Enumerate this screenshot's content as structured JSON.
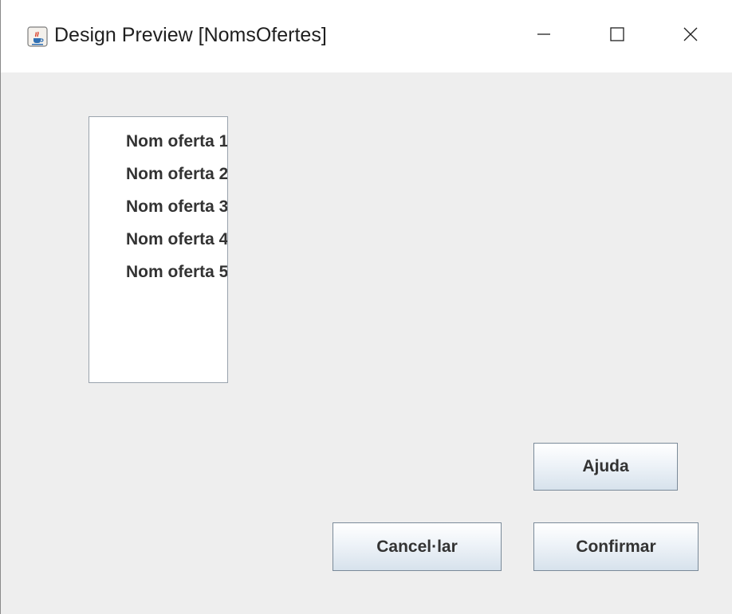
{
  "window": {
    "title": "Design Preview [NomsOfertes]",
    "app_icon": "java-cup-icon",
    "controls": [
      "minimize-icon",
      "maximize-icon",
      "close-icon"
    ]
  },
  "offer_list": {
    "items": [
      "Nom oferta 1",
      "Nom oferta 2",
      "Nom oferta 3",
      "Nom oferta 4",
      "Nom oferta 5"
    ]
  },
  "buttons": {
    "help": "Ajuda",
    "cancel": "Cancel·lar",
    "confirm": "Confirmar"
  },
  "colors": {
    "content_background": "#eeeeee",
    "titlebar_background": "#ffffff",
    "list_border": "#9aa3ad",
    "button_border": "#7a8a99",
    "button_text": "#333333"
  }
}
